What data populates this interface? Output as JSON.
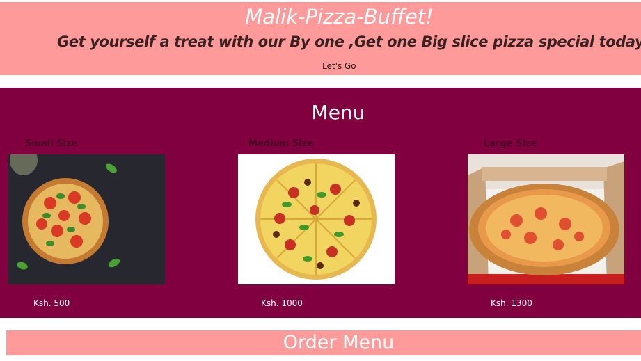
{
  "hero": {
    "title": "Malik-Pizza-Buffet!",
    "tagline": "Get yourself a treat with our By one ,Get one Big slice pizza special today!!!.",
    "cta_label": "Let's Go"
  },
  "menu": {
    "title": "Menu",
    "items": [
      {
        "size": "Small Size",
        "price": "Ksh. 500",
        "image": "pizza-on-dark-board"
      },
      {
        "size": "Medium Size",
        "price": "Ksh. 1000",
        "image": "pizza-on-white"
      },
      {
        "size": "Large Size",
        "price": "Ksh. 1300",
        "image": "pizza-in-box"
      }
    ]
  },
  "order": {
    "title": "Order Menu"
  },
  "colors": {
    "hero_bg": "#ff9a9a",
    "menu_bg": "#800040",
    "text_light": "#ffffff"
  }
}
